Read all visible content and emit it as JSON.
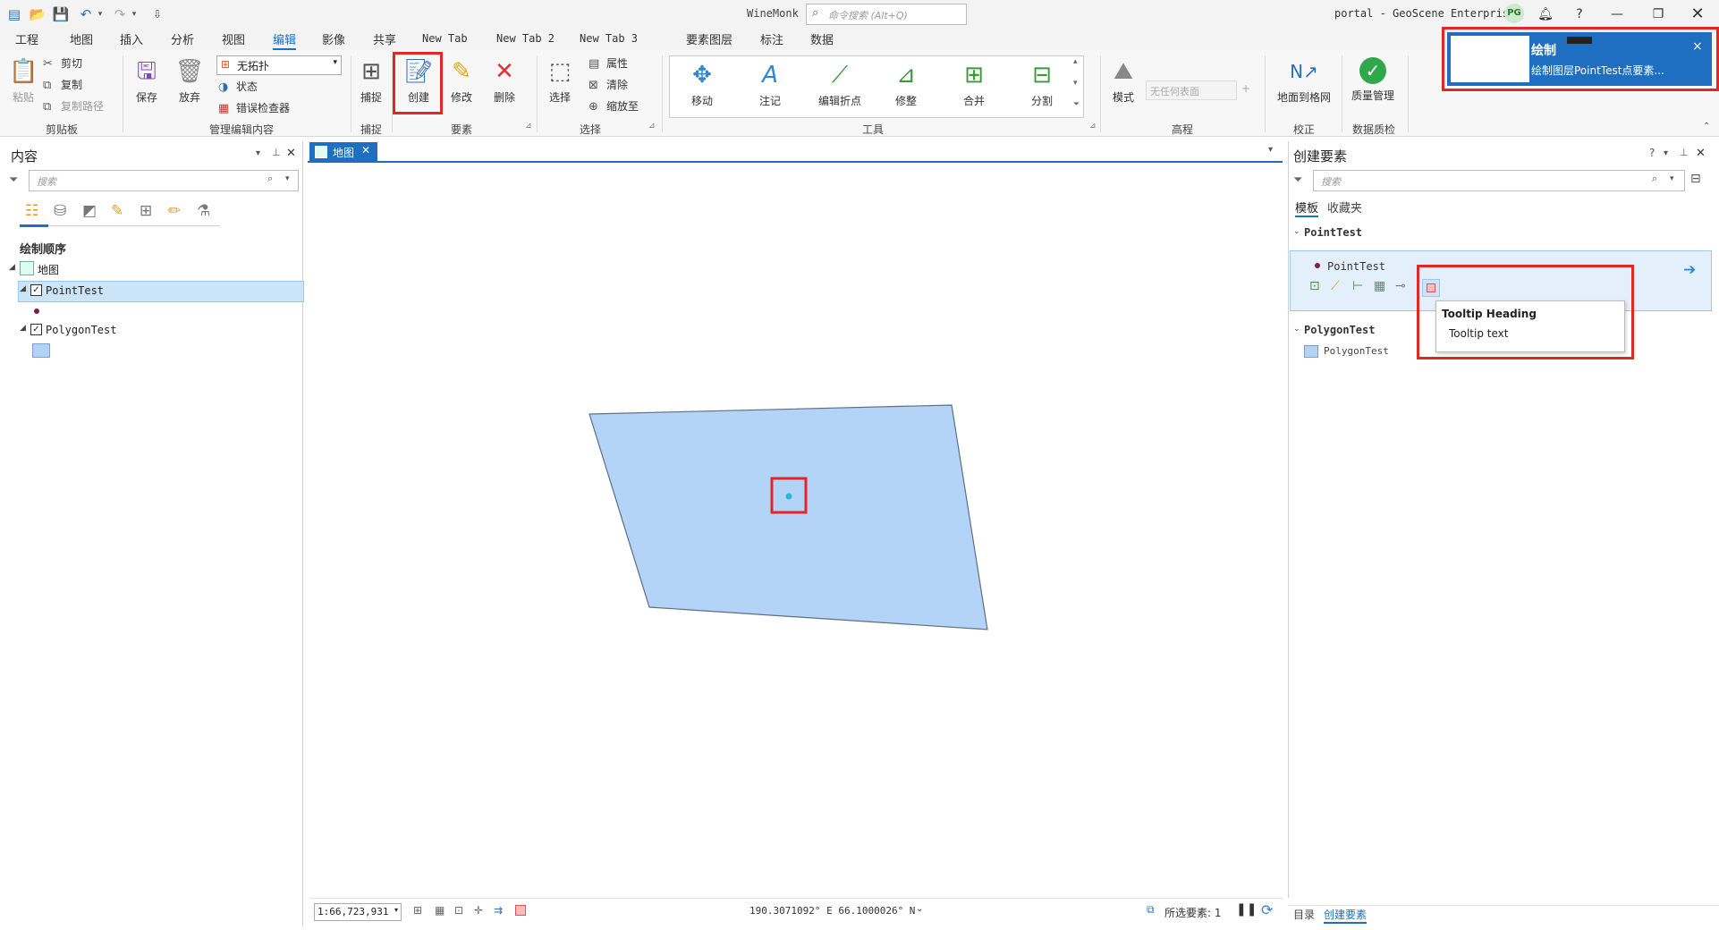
{
  "titlebar": {
    "app_name": "WineMonk",
    "search_placeholder": "命令搜索 (Alt+Q)",
    "portal": "portal - GeoScene Enterprise",
    "avatar_initials": "PG"
  },
  "ribbon_tabs": [
    "工程",
    "地图",
    "插入",
    "分析",
    "视图",
    "编辑",
    "影像",
    "共享",
    "New Tab",
    "New Tab 2",
    "New Tab 3",
    "要素图层",
    "标注",
    "数据"
  ],
  "active_tab": "编辑",
  "ribbon": {
    "clipboard": {
      "paste": "粘贴",
      "cut": "剪切",
      "copy": "复制",
      "copy_path": "复制路径",
      "label": "剪贴板"
    },
    "manage_edits": {
      "save": "保存",
      "discard": "放弃",
      "topology": "无拓扑",
      "status": "状态",
      "error_inspector": "错误检查器",
      "label": "管理编辑内容"
    },
    "snapping": {
      "snap": "捕捉",
      "label": "捕捉"
    },
    "features": {
      "create": "创建",
      "modify": "修改",
      "delete": "删除",
      "label": "要素"
    },
    "selection": {
      "select": "选择",
      "attributes": "属性",
      "clear": "清除",
      "zoom_to": "缩放至",
      "label": "选择"
    },
    "tools": {
      "move": "移动",
      "annotate": "注记",
      "edit_vertices": "编辑折点",
      "reshape": "修整",
      "merge": "合并",
      "split": "分割",
      "label": "工具"
    },
    "elevation": {
      "mode": "模式",
      "surface_placeholder": "无任何表面",
      "label": "高程"
    },
    "correction": {
      "ground_to_grid": "地面到格网",
      "label": "校正"
    },
    "data_quality": {
      "quality_mgmt": "质量管理",
      "label": "数据质检"
    }
  },
  "notification": {
    "title": "绘制",
    "text": "绘制图层PointTest点要素...",
    "close": "×"
  },
  "contents_pane": {
    "title": "内容",
    "search_placeholder": "搜索",
    "drawing_order": "绘制顺序",
    "map_name": "地图",
    "layers": [
      {
        "name": "PointTest",
        "checked": true,
        "selected": true
      },
      {
        "name": "PolygonTest",
        "checked": true,
        "selected": false
      }
    ]
  },
  "map_view": {
    "tab_label": "地图",
    "scale": "1:66,723,931",
    "coordinates": "190.3071092° E 66.1000026° N",
    "selected_features": "所选要素: 1"
  },
  "create_features_pane": {
    "title": "创建要素",
    "search_placeholder": "搜索",
    "tabs": [
      "模板",
      "收藏夹"
    ],
    "active_tab": "模板",
    "groups": [
      {
        "group": "PointTest",
        "template": "PointTest"
      },
      {
        "group": "PolygonTest",
        "template": "PolygonTest"
      }
    ]
  },
  "tooltip": {
    "heading": "Tooltip Heading",
    "text": "Tooltip text"
  },
  "bottom_tabs": [
    "目录",
    "创建要素"
  ],
  "colors": {
    "accent": "#1e6fc2",
    "highlight_red": "#e32626",
    "polygon_fill": "#b3d3f7",
    "point_fill": "#2bb5d8",
    "selection_bg": "#cce4f7"
  }
}
